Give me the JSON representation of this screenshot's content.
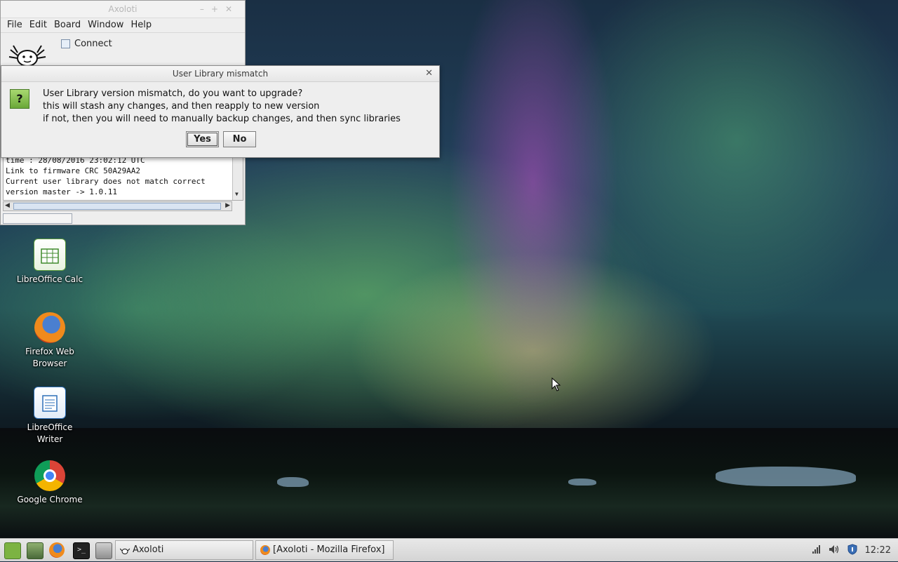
{
  "main_window": {
    "title": "Axoloti",
    "menu": [
      "File",
      "Edit",
      "Board",
      "Window",
      "Help"
    ],
    "connect_label": "Connect",
    "console_lines": [
      "time : 28/08/2016 23:02:12 UTC",
      "Link to firmware CRC 50A29AA2",
      "Current user library does not match correct",
      "version master -> 1.0.11"
    ]
  },
  "dialog": {
    "title": "User Library mismatch",
    "message_line1": "User Library version mismatch, do you want to upgrade?",
    "message_line2": "this will stash any changes, and then reapply to new version",
    "message_line3": "if not, then you will need to manually backup changes, and then sync libraries",
    "yes_label": "Yes",
    "no_label": "No",
    "icon": "question-icon"
  },
  "desktop_icons": [
    {
      "label": "LibreOffice Calc",
      "icon": "libreoffice-calc-icon"
    },
    {
      "label": "Firefox Web Browser",
      "icon": "firefox-icon"
    },
    {
      "label": "LibreOffice Writer",
      "icon": "libreoffice-writer-icon"
    },
    {
      "label": "Google Chrome",
      "icon": "chrome-icon"
    }
  ],
  "taskbar": {
    "tasks": [
      "Axoloti",
      "[Axoloti - Mozilla Firefox]"
    ],
    "clock": "12:22",
    "launchers": [
      "mint-menu-icon",
      "show-desktop-icon",
      "firefox-icon",
      "terminal-icon",
      "files-icon"
    ],
    "tray_icons": [
      "network-icon",
      "volume-icon",
      "update-shield-icon"
    ]
  }
}
